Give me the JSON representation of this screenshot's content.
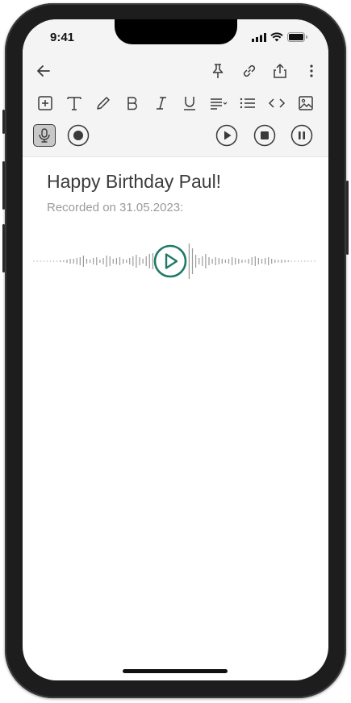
{
  "status_bar": {
    "time": "9:41"
  },
  "note": {
    "title": "Happy Birthday Paul!",
    "recorded_label": "Recorded on 31.05.2023:"
  },
  "icons": {
    "top_row": [
      "back-arrow-icon",
      "pin-icon",
      "link-icon",
      "share-icon",
      "more-vertical-icon"
    ],
    "format_row": [
      "add-block-icon",
      "text-icon",
      "pencil-icon",
      "bold-icon",
      "italic-icon",
      "underline-icon",
      "align-icon",
      "list-icon",
      "code-icon",
      "image-icon"
    ],
    "audio_row": [
      "microphone-icon",
      "record-icon",
      "play-icon",
      "stop-icon",
      "pause-icon"
    ]
  },
  "colors": {
    "accent": "#1e7a68",
    "toolbar_bg": "#f4f4f4",
    "icon": "#3a3a3a",
    "mic_active_bg": "#c8c8c8",
    "waveform": "#9a9a9a"
  },
  "audio": {
    "playing": false
  }
}
